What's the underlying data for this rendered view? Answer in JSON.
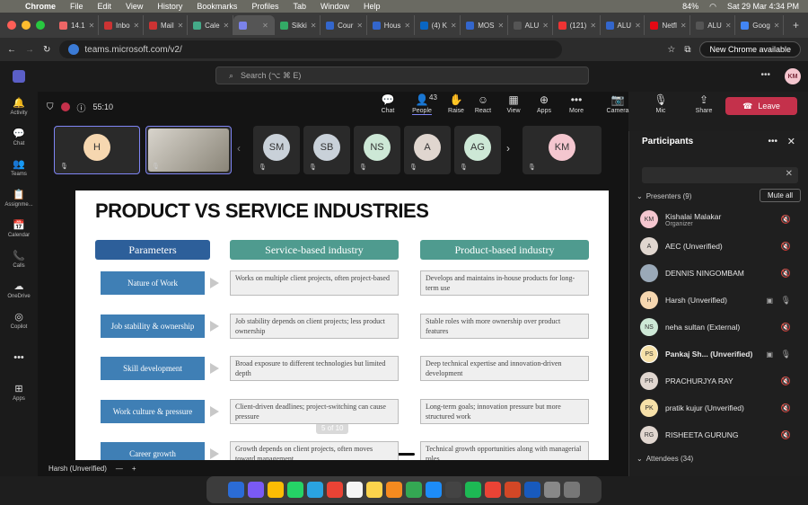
{
  "menubar": {
    "items": [
      "Chrome",
      "File",
      "Edit",
      "View",
      "History",
      "Bookmarks",
      "Profiles",
      "Tab",
      "Window",
      "Help"
    ],
    "battery": "84%",
    "datetime": "Sat 29 Mar  4:34 PM"
  },
  "tabs": [
    {
      "label": "14.1",
      "color": "#e66"
    },
    {
      "label": "Inbo",
      "color": "#c33"
    },
    {
      "label": "Mail",
      "color": "#c33"
    },
    {
      "label": "Cale",
      "color": "#4a8"
    },
    {
      "label": "",
      "color": "#7b83eb"
    },
    {
      "label": "Sikki",
      "color": "#3a6"
    },
    {
      "label": "Cour",
      "color": "#36c"
    },
    {
      "label": "Hous",
      "color": "#36c"
    },
    {
      "label": "(4) K",
      "color": "#0a66c2"
    },
    {
      "label": "MOS",
      "color": "#36c"
    },
    {
      "label": "ALU",
      "color": "#555"
    },
    {
      "label": "(121)",
      "color": "#e33"
    },
    {
      "label": "ALU",
      "color": "#36c"
    },
    {
      "label": "Netfl",
      "color": "#e50914"
    },
    {
      "label": "ALU",
      "color": "#555"
    },
    {
      "label": "Goog",
      "color": "#4285f4"
    }
  ],
  "browser": {
    "url": "teams.microsoft.com/v2/",
    "new_chrome": "New Chrome available"
  },
  "teams": {
    "search_placeholder": "Search (⌥ ⌘ E)",
    "user_initials": "KM"
  },
  "rail": [
    {
      "label": "Activity",
      "icon": "bell-icon",
      "glyph": "🔔"
    },
    {
      "label": "Chat",
      "icon": "chat-icon",
      "glyph": "💬"
    },
    {
      "label": "Teams",
      "icon": "teams-icon",
      "glyph": "👥"
    },
    {
      "label": "Assignme...",
      "icon": "assignments-icon",
      "glyph": "📋"
    },
    {
      "label": "Calendar",
      "icon": "calendar-icon",
      "glyph": "📅"
    },
    {
      "label": "Calls",
      "icon": "phone-icon",
      "glyph": "📞"
    },
    {
      "label": "OneDrive",
      "icon": "onedrive-icon",
      "glyph": "☁"
    },
    {
      "label": "Copilot",
      "icon": "copilot-icon",
      "glyph": "◎"
    },
    {
      "label": "",
      "icon": "more-icon",
      "glyph": "•••"
    },
    {
      "label": "Apps",
      "icon": "apps-icon",
      "glyph": "⊞"
    }
  ],
  "meeting": {
    "timer": "55:10",
    "people_count": "43",
    "toolbar": [
      {
        "label": "Chat",
        "glyph": "💬"
      },
      {
        "label": "People",
        "glyph": "👤"
      },
      {
        "label": "Raise",
        "glyph": "✋"
      },
      {
        "label": "React",
        "glyph": "☺"
      },
      {
        "label": "View",
        "glyph": "▦"
      },
      {
        "label": "Apps",
        "glyph": "⊕"
      },
      {
        "label": "More",
        "glyph": "•••"
      },
      {
        "label": "Camera",
        "glyph": "📷"
      },
      {
        "label": "Mic",
        "glyph": "🎙"
      },
      {
        "label": "Share",
        "glyph": "⇪"
      }
    ],
    "leave_label": "Leave",
    "tiles": [
      {
        "initials": "H",
        "color": "#f6d7b0"
      },
      {
        "initials": "",
        "color": "#777"
      },
      {
        "initials": "SM",
        "color": "#c9d1d9"
      },
      {
        "initials": "SB",
        "color": "#c9d1d9"
      },
      {
        "initials": "NS",
        "color": "#cde8d6"
      },
      {
        "initials": "A",
        "color": "#e0d6cf"
      },
      {
        "initials": "AG",
        "color": "#cde8d6"
      },
      {
        "initials": "KM",
        "color": "#f4c6cf"
      }
    ],
    "presenter_label": "Harsh (Unverified)"
  },
  "slide": {
    "title": "PRODUCT VS SERVICE INDUSTRIES",
    "headers": [
      "Parameters",
      "Service-based industry",
      "Product-based industry"
    ],
    "rows": [
      {
        "param": "Nature of Work",
        "service": "Works on multiple client projects, often project-based",
        "product": "Develops and maintains in-house products for long-term use"
      },
      {
        "param": "Job stability & ownership",
        "service": "Job stability depends on client projects; less product ownership",
        "product": "Stable roles with more ownership over product features"
      },
      {
        "param": "Skill development",
        "service": "Broad exposure to different technologies but limited depth",
        "product": "Deep technical expertise and innovation-driven development"
      },
      {
        "param": "Work culture & pressure",
        "service": "Client-driven deadlines; project-switching can cause pressure",
        "product": "Long-term goals; innovation pressure but more structured work"
      },
      {
        "param": "Career growth",
        "service": "Growth depends on client projects, often moves toward management",
        "product": "Technical growth opportunities along with managerial roles"
      }
    ],
    "counter": "5 of 10"
  },
  "participants": {
    "title": "Participants",
    "presenters_label": "Presenters (9)",
    "mute_all": "Mute all",
    "attendees_label": "Attendees (34)",
    "list": [
      {
        "initials": "KM",
        "name": "Kishalai Malakar",
        "role": "Organizer",
        "color": "#f4c6cf",
        "bold": false
      },
      {
        "initials": "A",
        "name": "AEC (Unverified)",
        "role": "",
        "color": "#e0d6cf",
        "bold": false
      },
      {
        "initials": "",
        "name": "DENNIS NINGOMBAM",
        "role": "",
        "color": "#9aa9b8",
        "bold": false
      },
      {
        "initials": "H",
        "name": "Harsh (Unverified)",
        "role": "",
        "color": "#f6d7b0",
        "bold": false
      },
      {
        "initials": "NS",
        "name": "neha sultan (External)",
        "role": "",
        "color": "#cde8d6",
        "bold": false
      },
      {
        "initials": "PS",
        "name": "Pankaj Sh... (Unverified)",
        "role": "",
        "color": "#f6e0a8",
        "bold": true
      },
      {
        "initials": "PR",
        "name": "PRACHURJYA RAY",
        "role": "",
        "color": "#e0d6cf",
        "bold": false
      },
      {
        "initials": "PK",
        "name": "pratik kujur (Unverified)",
        "role": "",
        "color": "#f6e0a8",
        "bold": false
      },
      {
        "initials": "RG",
        "name": "RISHEETA GURUNG",
        "role": "",
        "color": "#e0d6cf",
        "bold": false
      }
    ]
  }
}
